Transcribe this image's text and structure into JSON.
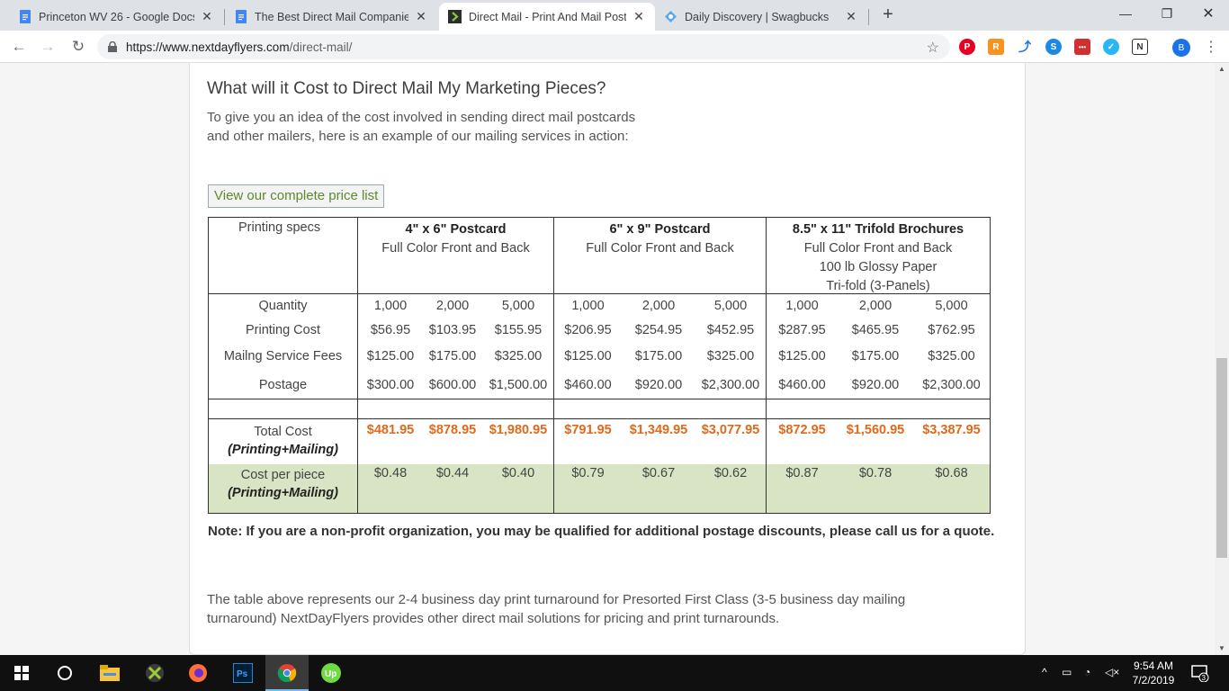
{
  "browser": {
    "tabs": [
      {
        "title": "Princeton WV 26 - Google Docs",
        "icon": "google-docs-icon"
      },
      {
        "title": "The Best Direct Mail Companies",
        "icon": "google-docs-icon"
      },
      {
        "title": "Direct Mail - Print And Mail Postc",
        "icon": "nextdayflyers-icon"
      },
      {
        "title": "Daily Discovery | Swagbucks",
        "icon": "swagbucks-icon"
      }
    ],
    "url_host": "https://www.nextdayflyers.com",
    "url_path": "/direct-mail/",
    "profile_initial": "B"
  },
  "page": {
    "heading": "What will it Cost to Direct Mail My Marketing Pieces?",
    "intro_line1": "To give you an idea of the cost involved in sending direct mail postcards",
    "intro_line2": "and other mailers, here is an example of our mailing services in action:",
    "price_list_button": "View our complete price list",
    "note": "Note:  If you are a non-profit organization, you may be qualified for additional postage discounts, please call us for a quote.",
    "para_line1": "The table above represents our 2-4 business day print turnaround for Presorted First Class (3-5 business day mailing",
    "para_line2": "turnaround) NextDayFlyers provides other direct mail solutions for pricing and print turnarounds."
  },
  "table": {
    "specs_label": "Printing specs",
    "products": [
      {
        "title": "4\" x 6\" Postcard",
        "lines": [
          "Full Color Front and Back"
        ]
      },
      {
        "title": "6\" x 9\" Postcard",
        "lines": [
          "Full Color Front and Back"
        ]
      },
      {
        "title": "8.5\" x 11\" Trifold Brochures",
        "lines": [
          "Full Color Front and Back",
          "100 lb Glossy Paper",
          "Tri-fold (3-Panels)"
        ]
      }
    ],
    "row_labels": {
      "quantity": "Quantity",
      "printing": "Printing Cost",
      "mailing": "Mailng Service Fees",
      "postage": "Postage",
      "total": "Total Cost",
      "per_piece": "Cost per piece",
      "paren": "(Printing+Mailing)"
    },
    "quantity": [
      "1,000",
      "2,000",
      "5,000",
      "1,000",
      "2,000",
      "5,000",
      "1,000",
      "2,000",
      "5,000"
    ],
    "printing": [
      "$56.95",
      "$103.95",
      "$155.95",
      "$206.95",
      "$254.95",
      "$452.95",
      "$287.95",
      "$465.95",
      "$762.95"
    ],
    "mailing": [
      "$125.00",
      "$175.00",
      "$325.00",
      "$125.00",
      "$175.00",
      "$325.00",
      "$125.00",
      "$175.00",
      "$325.00"
    ],
    "postage": [
      "$300.00",
      "$600.00",
      "$1,500.00",
      "$460.00",
      "$920.00",
      "$2,300.00",
      "$460.00",
      "$920.00",
      "$2,300.00"
    ],
    "total": [
      "$481.95",
      "$878.95",
      "$1,980.95",
      "$791.95",
      "$1,349.95",
      "$3,077.95",
      "$872.95",
      "$1,560.95",
      "$3,387.95"
    ],
    "per_piece": [
      "$0.48",
      "$0.44",
      "$0.40",
      "$0.79",
      "$0.67",
      "$0.62",
      "$0.87",
      "$0.78",
      "$0.68"
    ]
  },
  "taskbar": {
    "clock_time": "9:54 AM",
    "clock_date": "7/2/2019",
    "notification_count": "3"
  }
}
